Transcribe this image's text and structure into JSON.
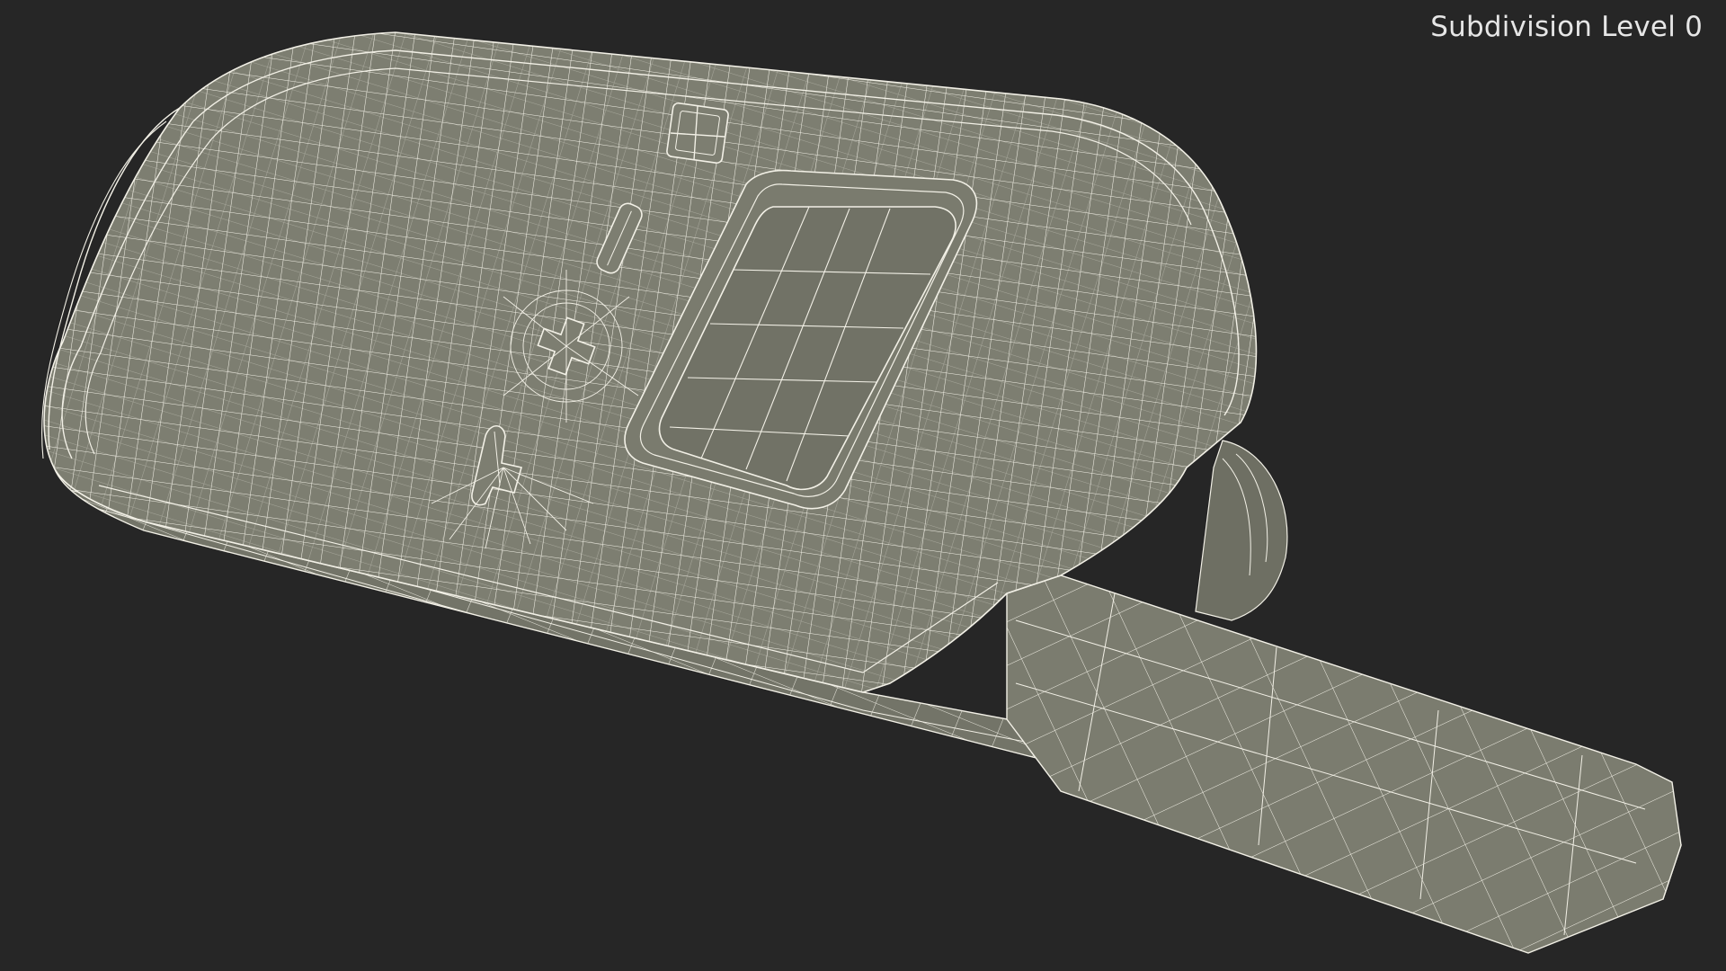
{
  "viewport": {
    "overlay_label": "Subdivision Level 0",
    "background_color": "#262626",
    "mesh_fill_color": "#7b7c6f",
    "wire_color": "#f2f0e6"
  }
}
